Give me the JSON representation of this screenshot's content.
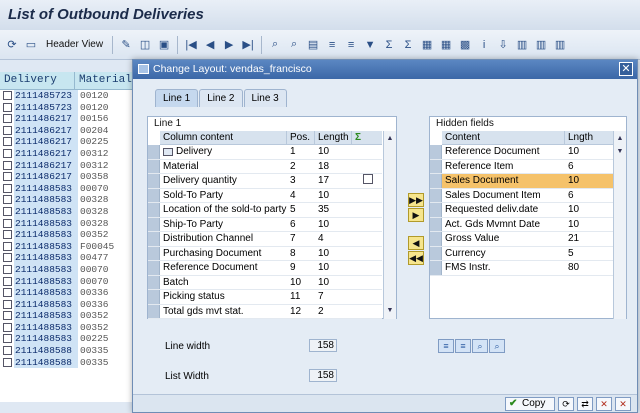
{
  "app": {
    "title": "List of Outbound Deliveries"
  },
  "toolbar": {
    "header_view_label": "Header View"
  },
  "background_list": {
    "columns": [
      "Delivery",
      "Material"
    ],
    "rows": [
      [
        "2111485723",
        "00120"
      ],
      [
        "2111485723",
        "00120"
      ],
      [
        "2111486217",
        "00156"
      ],
      [
        "2111486217",
        "00204"
      ],
      [
        "2111486217",
        "00225"
      ],
      [
        "2111486217",
        "00312"
      ],
      [
        "2111486217",
        "00312"
      ],
      [
        "2111486217",
        "00358"
      ],
      [
        "2111488583",
        "00070"
      ],
      [
        "2111488583",
        "00328"
      ],
      [
        "2111488583",
        "00328"
      ],
      [
        "2111488583",
        "00328"
      ],
      [
        "2111488583",
        "00352"
      ],
      [
        "2111488583",
        "F00045"
      ],
      [
        "2111488583",
        "00477"
      ],
      [
        "2111488583",
        "00070"
      ],
      [
        "2111488583",
        "00070"
      ],
      [
        "2111488583",
        "00336"
      ],
      [
        "2111488583",
        "00336"
      ],
      [
        "2111488583",
        "00352"
      ],
      [
        "2111488583",
        "00352"
      ],
      [
        "2111488583",
        "00225"
      ],
      [
        "2111488588",
        "00335"
      ],
      [
        "2111488588",
        "00335"
      ]
    ]
  },
  "dialog": {
    "title": "Change Layout: vendas_francisco",
    "tabs": [
      "Line 1",
      "Line 2",
      "Line 3"
    ],
    "left_panel": {
      "title": "Line 1",
      "columns": [
        "Column content",
        "Pos.",
        "Length"
      ],
      "rows": [
        [
          "Delivery",
          "1",
          "10"
        ],
        [
          "Material",
          "2",
          "18"
        ],
        [
          "Delivery quantity",
          "3",
          "17"
        ],
        [
          "Sold-To Party",
          "4",
          "10"
        ],
        [
          "Location of the sold-to party",
          "5",
          "35"
        ],
        [
          "Ship-To Party",
          "6",
          "10"
        ],
        [
          "Distribution Channel",
          "7",
          "4"
        ],
        [
          "Purchasing Document",
          "8",
          "10"
        ],
        [
          "Reference Document",
          "9",
          "10"
        ],
        [
          "Batch",
          "10",
          "10"
        ],
        [
          "Picking status",
          "11",
          "7"
        ],
        [
          "Total gds mvt stat.",
          "12",
          "2"
        ]
      ]
    },
    "right_panel": {
      "title": "Hidden fields",
      "columns": [
        "Content",
        "Lngth"
      ],
      "rows": [
        [
          "Reference Document",
          "10"
        ],
        [
          "Reference Item",
          "6"
        ],
        [
          "Sales Document",
          "10"
        ],
        [
          "Sales Document Item",
          "6"
        ],
        [
          "Requested deliv.date",
          "10"
        ],
        [
          "Act. Gds Mvmnt Date",
          "10"
        ],
        [
          "Gross Value",
          "21"
        ],
        [
          "Currency",
          "5"
        ],
        [
          "FMS Instr.",
          "80"
        ]
      ],
      "highlighted_index": 2
    },
    "line_width_label": "Line width",
    "line_width_value": "158",
    "list_width_label": "List Width",
    "list_width_value": "158",
    "copy_label": "Copy"
  }
}
